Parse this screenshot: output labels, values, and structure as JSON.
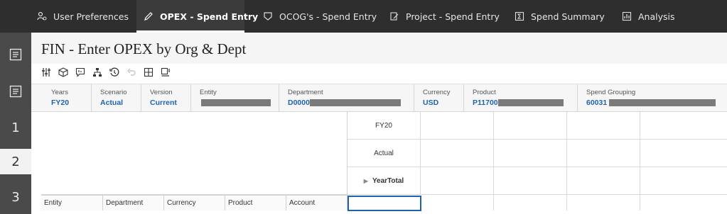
{
  "tabs": [
    {
      "label": "User Preferences",
      "icon": "user-gear-icon"
    },
    {
      "label": "OPEX - Spend Entry",
      "icon": "pencil-icon"
    },
    {
      "label": "OCOG's - Spend Entry",
      "icon": "badge-icon"
    },
    {
      "label": "Project - Spend Entry",
      "icon": "edit-doc-icon"
    },
    {
      "label": "Spend Summary",
      "icon": "sigma-icon"
    },
    {
      "label": "Analysis",
      "icon": "chart-icon"
    }
  ],
  "sidebar": {
    "items": [
      "1",
      "2",
      "3"
    ]
  },
  "page": {
    "title": "FIN - Enter OPEX by Org & Dept"
  },
  "pov": [
    {
      "label": "Years",
      "value": "FY20"
    },
    {
      "label": "Scenario",
      "value": "Actual"
    },
    {
      "label": "Version",
      "value": "Current"
    },
    {
      "label": "Entity",
      "value": ""
    },
    {
      "label": "Department",
      "value": "D0000"
    },
    {
      "label": "Currency",
      "value": "USD"
    },
    {
      "label": "Product",
      "value": "P11700"
    },
    {
      "label": "Spend Grouping",
      "value": "60031"
    }
  ],
  "grid": {
    "col_headers": [
      "FY20",
      "Actual",
      "YearTotal"
    ],
    "row_headers": [
      "Entity",
      "Department",
      "Currency",
      "Product",
      "Account"
    ]
  }
}
